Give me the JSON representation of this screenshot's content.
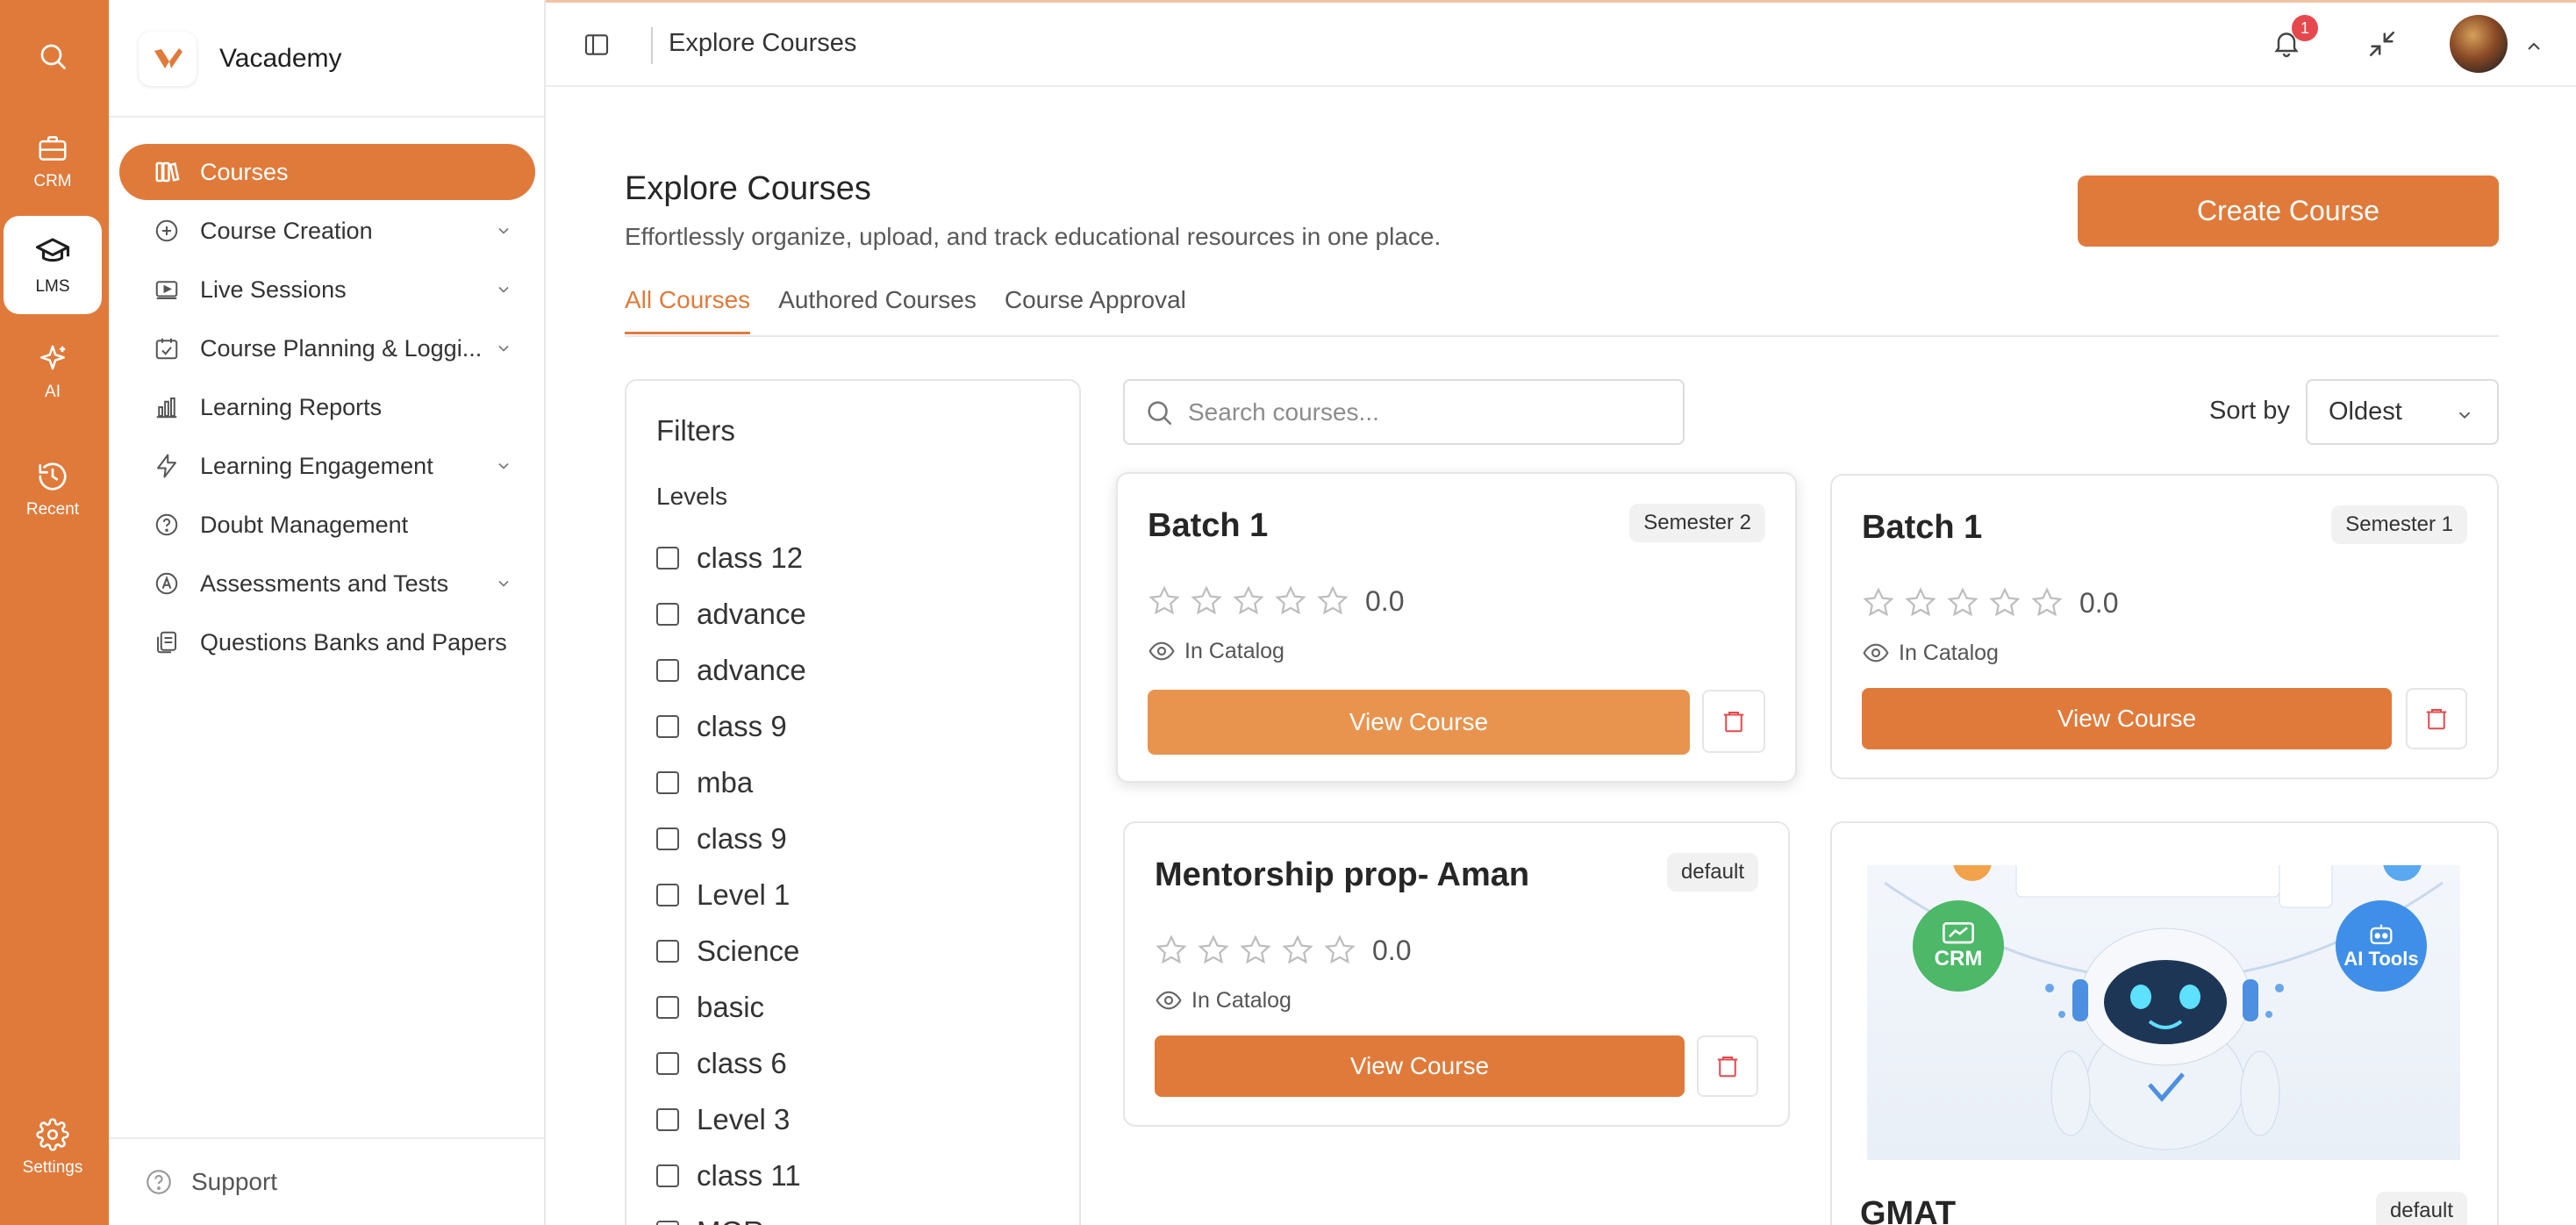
{
  "colors": {
    "accent": "#e07a3a",
    "accent_light": "#e8944f",
    "danger": "#e5484d"
  },
  "rail": {
    "items": [
      {
        "label": "",
        "icon": "search-icon"
      },
      {
        "label": "CRM",
        "icon": "briefcase-icon"
      },
      {
        "label": "LMS",
        "icon": "graduation-cap-icon",
        "active": true
      },
      {
        "label": "AI",
        "icon": "sparkles-icon"
      },
      {
        "label": "Recent",
        "icon": "history-icon"
      }
    ],
    "settings_label": "Settings"
  },
  "sidebar": {
    "brand": "Vacademy",
    "items": [
      {
        "label": "Courses",
        "icon": "book-icon",
        "active": true,
        "expandable": false
      },
      {
        "label": "Course Creation",
        "icon": "plus-circle-icon",
        "expandable": true
      },
      {
        "label": "Live Sessions",
        "icon": "video-icon",
        "expandable": true
      },
      {
        "label": "Course Planning & Loggi...",
        "icon": "calendar-check-icon",
        "expandable": true
      },
      {
        "label": "Learning Reports",
        "icon": "bar-chart-icon",
        "expandable": false
      },
      {
        "label": "Learning Engagement",
        "icon": "bolt-icon",
        "expandable": true
      },
      {
        "label": "Doubt Management",
        "icon": "question-circle-icon",
        "expandable": false
      },
      {
        "label": "Assessments and Tests",
        "icon": "badge-a-icon",
        "expandable": true
      },
      {
        "label": "Questions Banks and Papers",
        "icon": "file-copy-icon",
        "expandable": false
      }
    ],
    "support_label": "Support"
  },
  "header": {
    "title": "Explore Courses",
    "notification_count": "1"
  },
  "main": {
    "title": "Explore Courses",
    "subtitle": "Effortlessly organize, upload, and track educational resources in one place.",
    "create_button": "Create Course",
    "tabs": [
      {
        "label": "All Courses",
        "active": true
      },
      {
        "label": "Authored Courses"
      },
      {
        "label": "Course Approval"
      }
    ],
    "search_placeholder": "Search courses...",
    "sort_label": "Sort by",
    "sort_value": "Oldest"
  },
  "filters": {
    "title": "Filters",
    "levels_label": "Levels",
    "levels": [
      "class 12",
      "advance",
      "advance",
      "class 9",
      "mba",
      "class 9",
      "Level 1",
      "Science",
      "basic",
      "class 6",
      "Level 3",
      "class 11",
      "MGR"
    ]
  },
  "courses": [
    {
      "title": "Batch 1",
      "tag": "Semester 2",
      "rating": "0.0",
      "catalog": "In Catalog",
      "button": "View Course",
      "stars": 0
    },
    {
      "title": "Batch 1",
      "tag": "Semester 1",
      "rating": "0.0",
      "catalog": "In Catalog",
      "button": "View Course",
      "stars": 0
    },
    {
      "title": "Mentorship prop- Aman",
      "tag": "default",
      "rating": "0.0",
      "catalog": "In Catalog",
      "button": "View Course",
      "stars": 0
    },
    {
      "title": "GMAT",
      "tag": "default",
      "image_labels": [
        "CRM",
        "AI Tools"
      ]
    }
  ]
}
